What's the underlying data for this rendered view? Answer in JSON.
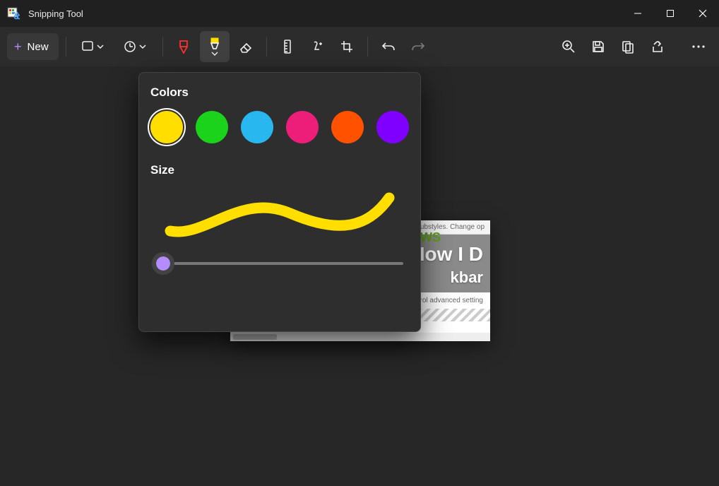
{
  "window": {
    "title": "Snipping Tool"
  },
  "toolbar": {
    "new_label": "New"
  },
  "popup": {
    "colors_label": "Colors",
    "size_label": "Size",
    "colors": [
      {
        "hex": "#ffde00",
        "selected": true
      },
      {
        "hex": "#1ad31a",
        "selected": false
      },
      {
        "hex": "#28b8ef",
        "selected": false
      },
      {
        "hex": "#ed1e79",
        "selected": false
      },
      {
        "hex": "#ff5100",
        "selected": false
      },
      {
        "hex": "#8000ff",
        "selected": false
      }
    ],
    "preview_color": "#ffde00",
    "size_value": 0
  },
  "snippet": {
    "top_text": "ubstyles.  Change op",
    "brand_fragment": "WS",
    "heading_line1": "How I D",
    "heading_line2": "kbar",
    "sub_text": "ontrol advanced setting"
  }
}
